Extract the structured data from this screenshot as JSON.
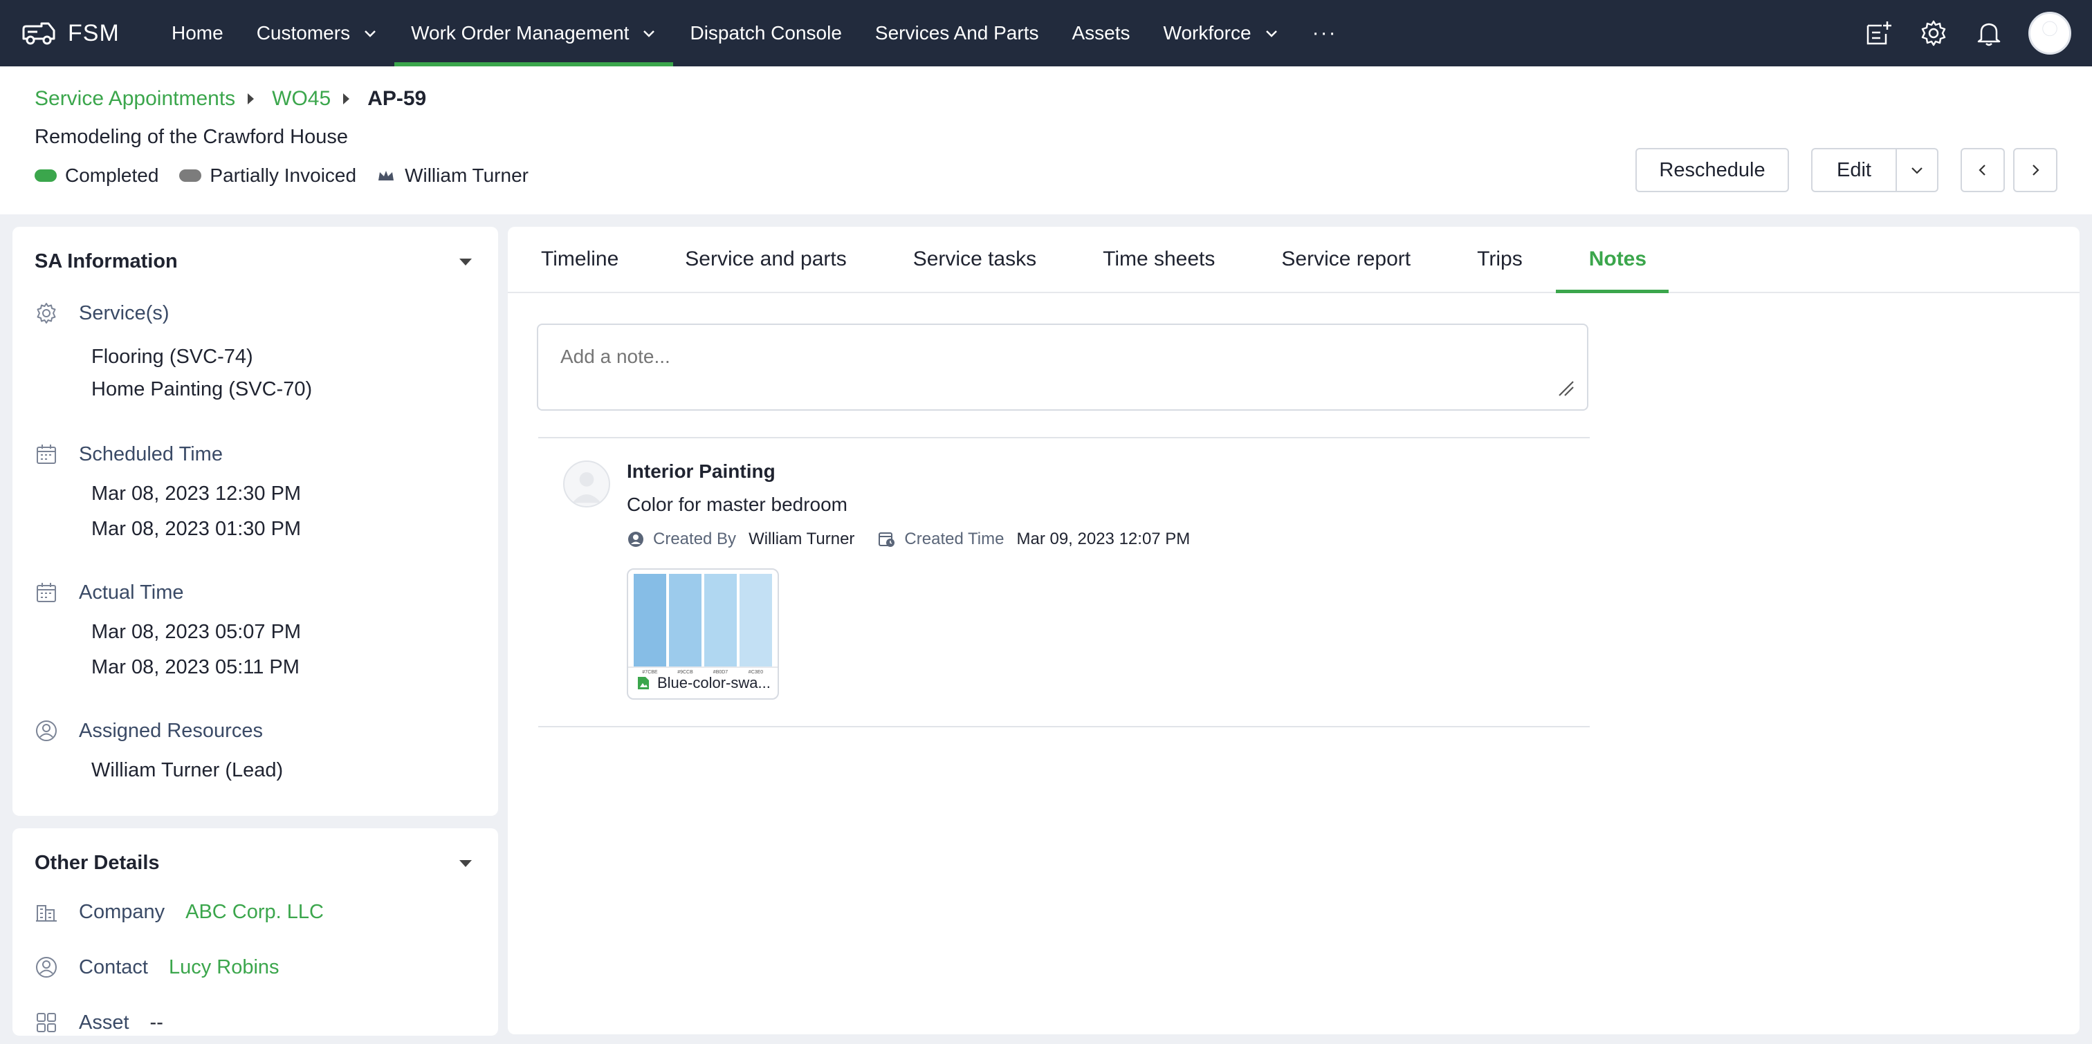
{
  "app": {
    "name": "FSM"
  },
  "nav": {
    "items": [
      {
        "label": "Home",
        "dropdown": false,
        "active": false
      },
      {
        "label": "Customers",
        "dropdown": true,
        "active": false
      },
      {
        "label": "Work Order Management",
        "dropdown": true,
        "active": true
      },
      {
        "label": "Dispatch Console",
        "dropdown": false,
        "active": false
      },
      {
        "label": "Services And Parts",
        "dropdown": false,
        "active": false
      },
      {
        "label": "Assets",
        "dropdown": false,
        "active": false
      },
      {
        "label": "Workforce",
        "dropdown": true,
        "active": false
      }
    ],
    "more": "···"
  },
  "breadcrumb": {
    "level1": "Service Appointments",
    "level2": "WO45",
    "current": "AP-59"
  },
  "header": {
    "title": "Remodeling of the Crawford House",
    "status": {
      "label": "Completed",
      "color": "#3ba64c"
    },
    "billing": {
      "label": "Partially Invoiced",
      "color": "#7c7c7c"
    },
    "owner": "William Turner"
  },
  "actions": {
    "reschedule": "Reschedule",
    "edit": "Edit"
  },
  "sa_info": {
    "title": "SA Information",
    "services_label": "Service(s)",
    "services": [
      "Flooring (SVC-74)",
      "Home Painting (SVC-70)"
    ],
    "scheduled_label": "Scheduled Time",
    "scheduled": [
      "Mar 08, 2023 12:30 PM",
      "Mar 08, 2023 01:30 PM"
    ],
    "actual_label": "Actual Time",
    "actual": [
      "Mar 08, 2023 05:07 PM",
      "Mar 08, 2023 05:11 PM"
    ],
    "resources_label": "Assigned Resources",
    "resources": [
      "William Turner (Lead)"
    ]
  },
  "other_details": {
    "title": "Other Details",
    "company_label": "Company",
    "company": "ABC Corp. LLC",
    "contact_label": "Contact",
    "contact": "Lucy Robins",
    "asset_label": "Asset",
    "asset": "--"
  },
  "tabs": [
    {
      "label": "Timeline",
      "active": false
    },
    {
      "label": "Service and parts",
      "active": false
    },
    {
      "label": "Service tasks",
      "active": false
    },
    {
      "label": "Time sheets",
      "active": false
    },
    {
      "label": "Service report",
      "active": false
    },
    {
      "label": "Trips",
      "active": false
    },
    {
      "label": "Notes",
      "active": true
    }
  ],
  "notes": {
    "placeholder": "Add a note...",
    "items": [
      {
        "title": "Interior Painting",
        "body": "Color for master bedroom",
        "created_by_label": "Created By",
        "created_by": "William Turner",
        "created_time_label": "Created Time",
        "created_time": "Mar 09, 2023 12:07 PM",
        "attachment": {
          "name": "Blue-color-swa...",
          "swatches": [
            "#86bde6",
            "#9ccbec",
            "#b0d7f1",
            "#c3e0f4"
          ],
          "swatch_codes": [
            "#7CBE",
            "#9CCB",
            "#B0D7",
            "#C3E0"
          ]
        }
      }
    ]
  }
}
